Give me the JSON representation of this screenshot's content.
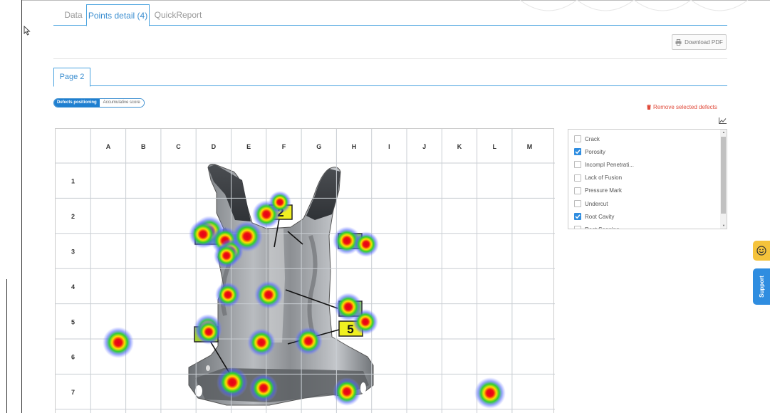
{
  "tabs": [
    {
      "label": "Data",
      "active": false
    },
    {
      "label": "Points detail (4)",
      "active": true
    },
    {
      "label": "QuickReport",
      "active": false
    }
  ],
  "download_label": "Download PDF",
  "subtab_label": "Page 2",
  "view_toggle": {
    "active": "Defects positioning",
    "inactive": "Accumulative score"
  },
  "remove_label": "Remove selected defects",
  "grid": {
    "columns": [
      "A",
      "B",
      "C",
      "D",
      "E",
      "F",
      "G",
      "H",
      "I",
      "J",
      "K",
      "L",
      "M"
    ],
    "rows": [
      "1",
      "2",
      "3",
      "4",
      "5",
      "6",
      "7"
    ]
  },
  "callout_labels": [
    "2",
    "5"
  ],
  "defects": [
    {
      "label": "Crack",
      "checked": false
    },
    {
      "label": "Porosity",
      "checked": true
    },
    {
      "label": "Incompl Penetrati...",
      "checked": false
    },
    {
      "label": "Lack of Fusion",
      "checked": false
    },
    {
      "label": "Pressure Mark",
      "checked": false
    },
    {
      "label": "Undercut",
      "checked": false
    },
    {
      "label": "Root Cavity",
      "checked": true
    },
    {
      "label": "Root Sagging",
      "checked": false
    }
  ],
  "support_label": "Support",
  "colors": {
    "accent": "#3b8ed0",
    "danger": "#e04a3a",
    "feedback": "#f5c33b",
    "heat_core": "#e3001b"
  }
}
